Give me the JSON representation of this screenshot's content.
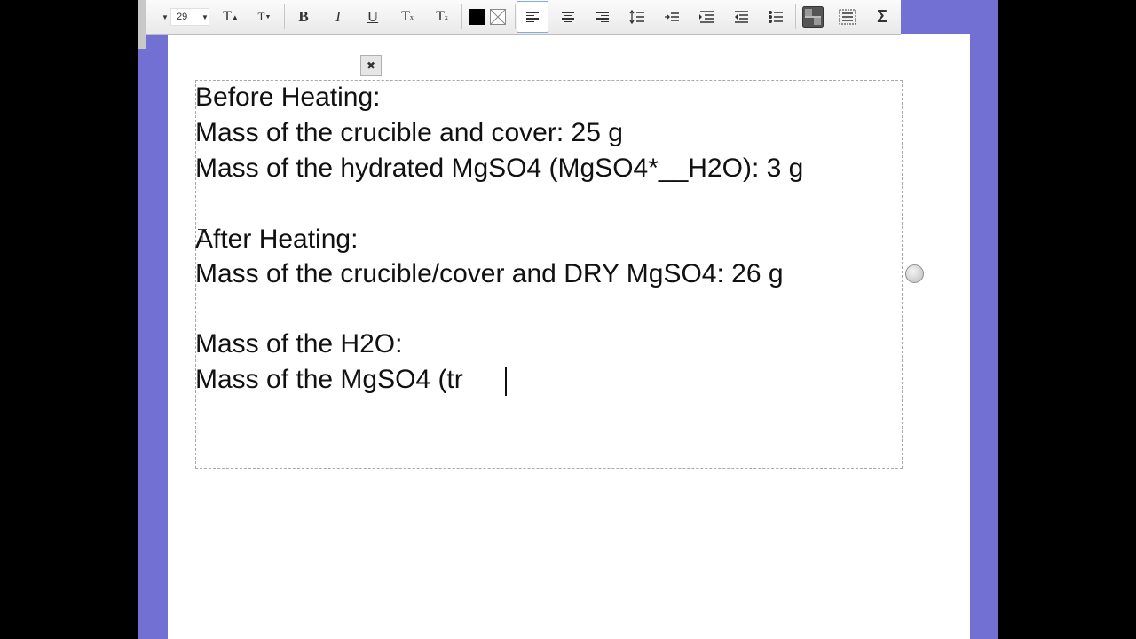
{
  "toolbar": {
    "font_size": "29",
    "superscript_icon_label": "T",
    "subscript_icon_label": "T",
    "bold_label": "B",
    "italic_label": "I",
    "underline_label": "U",
    "superscript_label": "T",
    "subscript_label": "T",
    "sigma_label": "Σ",
    "text_color": "#000000"
  },
  "editor": {
    "lines": [
      "Before Heating:",
      "Mass of the crucible and cover: 25 g",
      "Mass of the hydrated MgSO4 (MgSO4*__H2O): 3 g",
      "After Heating:",
      "Mass of the crucible/cover and DRY MgSO4: 26 g",
      "Mass of the H2O:",
      "Mass of the MgSO4 (tr"
    ]
  },
  "colors": {
    "side_panel": "#7370d4",
    "page": "#ffffff",
    "toolbar": "#efefef"
  }
}
